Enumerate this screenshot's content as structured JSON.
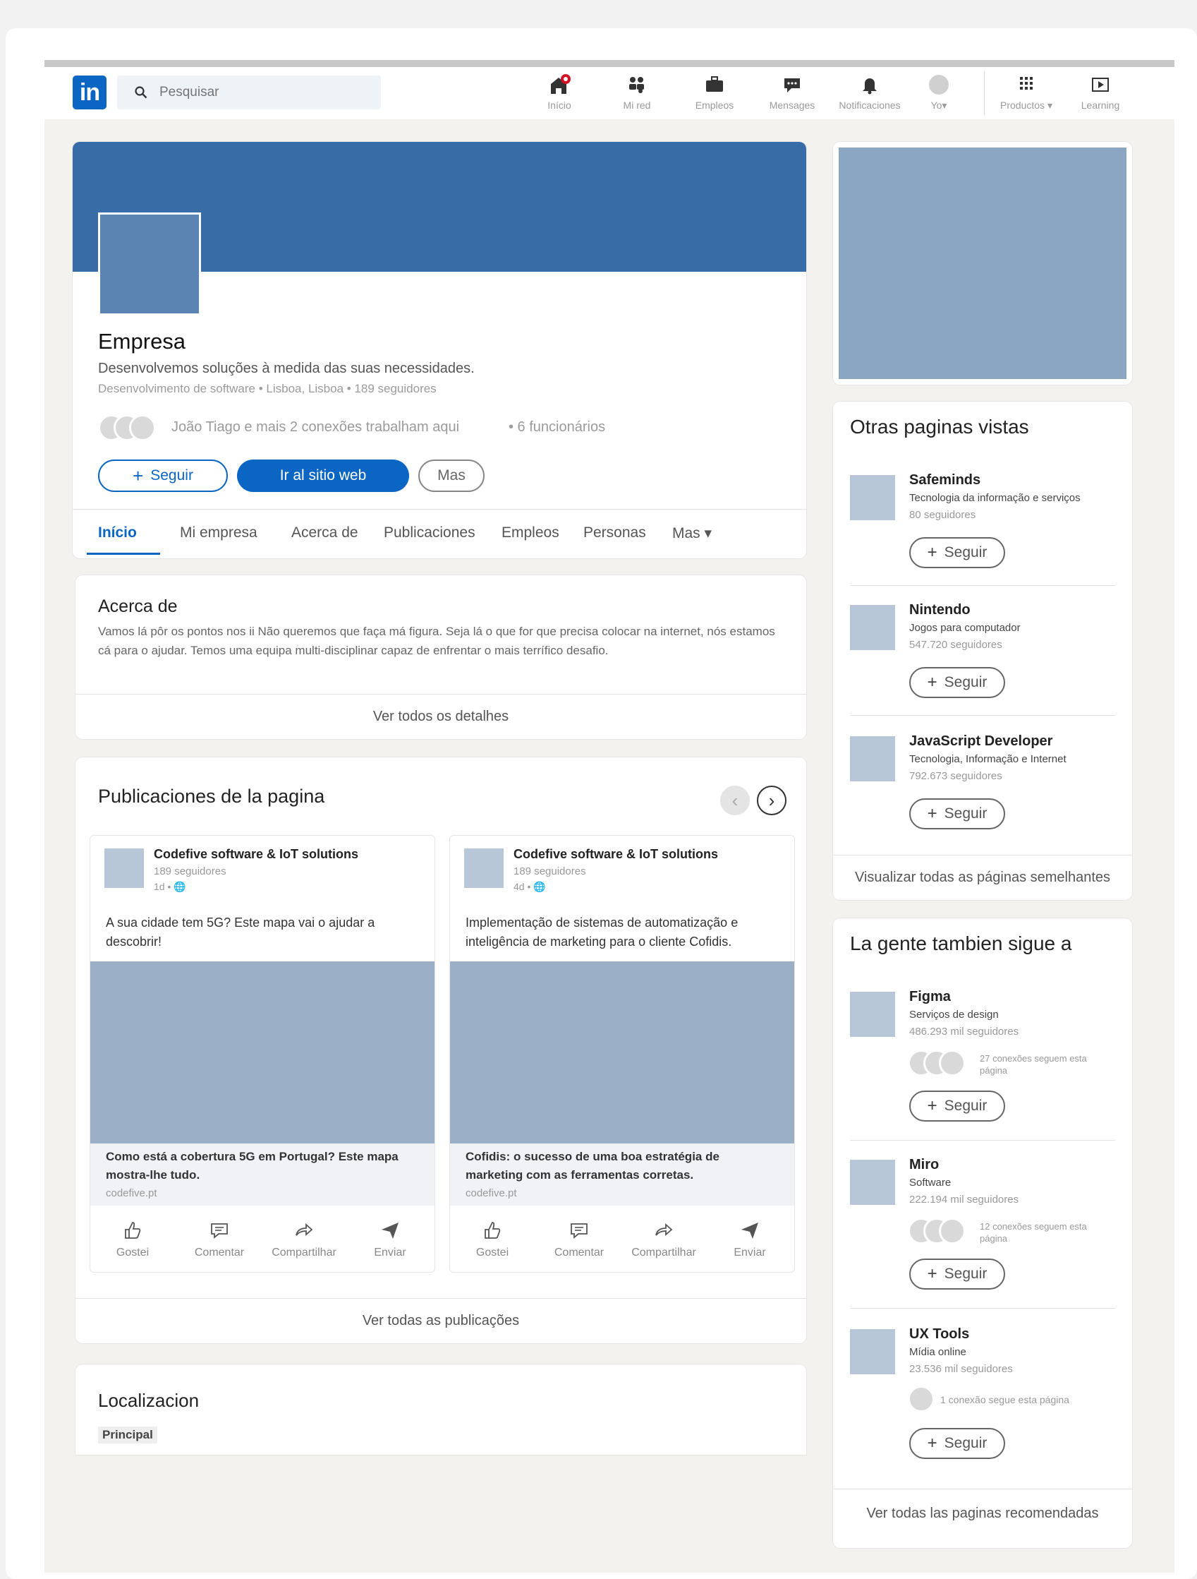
{
  "nav": {
    "logo": "in",
    "search_placeholder": "Pesquisar",
    "items": [
      "Início",
      "Mi red",
      "Empleos",
      "Mensages",
      "Notificaciones",
      "Yo▾",
      "Productos ▾",
      "Learning"
    ]
  },
  "company": {
    "name": "Empresa",
    "tagline": "Desenvolvemos soluções à medida das suas necessidades.",
    "meta": "Desenvolvimento de software • Lisboa, Lisboa • 189 seguidores",
    "connections": "João Tiago e mais 2 conexões trabalham aqui",
    "employees": "• 6 funcionários",
    "follow_label": "Seguir",
    "website_label": "Ir al sitio web",
    "more_label": "Mas"
  },
  "tabs": [
    "Início",
    "Mi empresa",
    "Acerca de",
    "Publicaciones",
    "Empleos",
    "Personas",
    "Mas ▾"
  ],
  "about": {
    "title": "Acerca de",
    "text": "Vamos lá pôr os pontos nos ii Não queremos que faça má figura. Seja lá o que for que precisa colocar na internet, nós estamos cá para o ajudar. Temos uma equipa multi-disciplinar capaz de enfrentar o mais terrífico desafio.",
    "details_link": "Ver todos os detalhes"
  },
  "posts_section": {
    "title": "Publicaciones de la pagina",
    "see_all": "Ver todas as publicações",
    "actions": [
      "Gostei",
      "Comentar",
      "Compartilhar",
      "Enviar"
    ],
    "posts": [
      {
        "author": "Codefive software & IoT solutions",
        "followers": "189 seguidores",
        "time": "1d • 🌐",
        "text": "A sua cidade tem 5G? Este mapa vai o ajudar a descobrir!",
        "link_title": "Como está a cobertura 5G em Portugal? Este mapa mostra-lhe tudo.",
        "link_url": "codefive.pt"
      },
      {
        "author": "Codefive software & IoT solutions",
        "followers": "189 seguidores",
        "time": "4d • 🌐",
        "text": "Implementação de sistemas de automatização e inteligência de marketing para o cliente Cofidis.",
        "link_title": "Cofidis: o sucesso de uma boa estratégia de marketing com as ferramentas corretas.",
        "link_url": "codefive.pt"
      }
    ]
  },
  "location": {
    "title": "Localizacion",
    "badge": "Principal"
  },
  "other_pages": {
    "title": "Otras paginas vistas",
    "see_all": "Visualizar todas as páginas semelhantes",
    "follow_label": "Seguir",
    "items": [
      {
        "name": "Safeminds",
        "category": "Tecnologia da informação e serviços",
        "followers": "80 seguidores"
      },
      {
        "name": "Nintendo",
        "category": "Jogos para computador",
        "followers": "547.720 seguidores"
      },
      {
        "name": "JavaScript Developer",
        "category": "Tecnologia, Informação e Internet",
        "followers": "792.673 seguidores"
      }
    ]
  },
  "people_follow": {
    "title": "La gente tambien sigue a",
    "see_all": "Ver todas las paginas recomendadas",
    "follow_label": "Seguir",
    "items": [
      {
        "name": "Figma",
        "category": "Serviços de design",
        "followers": "486.293 mil seguidores",
        "connections": "27 conexões seguem esta página"
      },
      {
        "name": "Miro",
        "category": "Software",
        "followers": "222.194 mil seguidores",
        "connections": "12 conexões seguem esta página"
      },
      {
        "name": "UX Tools",
        "category": "Mídia online",
        "followers": "23.536 mil seguidores",
        "connections": "1 conexão segue esta página"
      }
    ]
  },
  "colors": {
    "brand": "#0a66c2",
    "cover": "#376ca6",
    "placeholder": "#9bb0c7"
  }
}
